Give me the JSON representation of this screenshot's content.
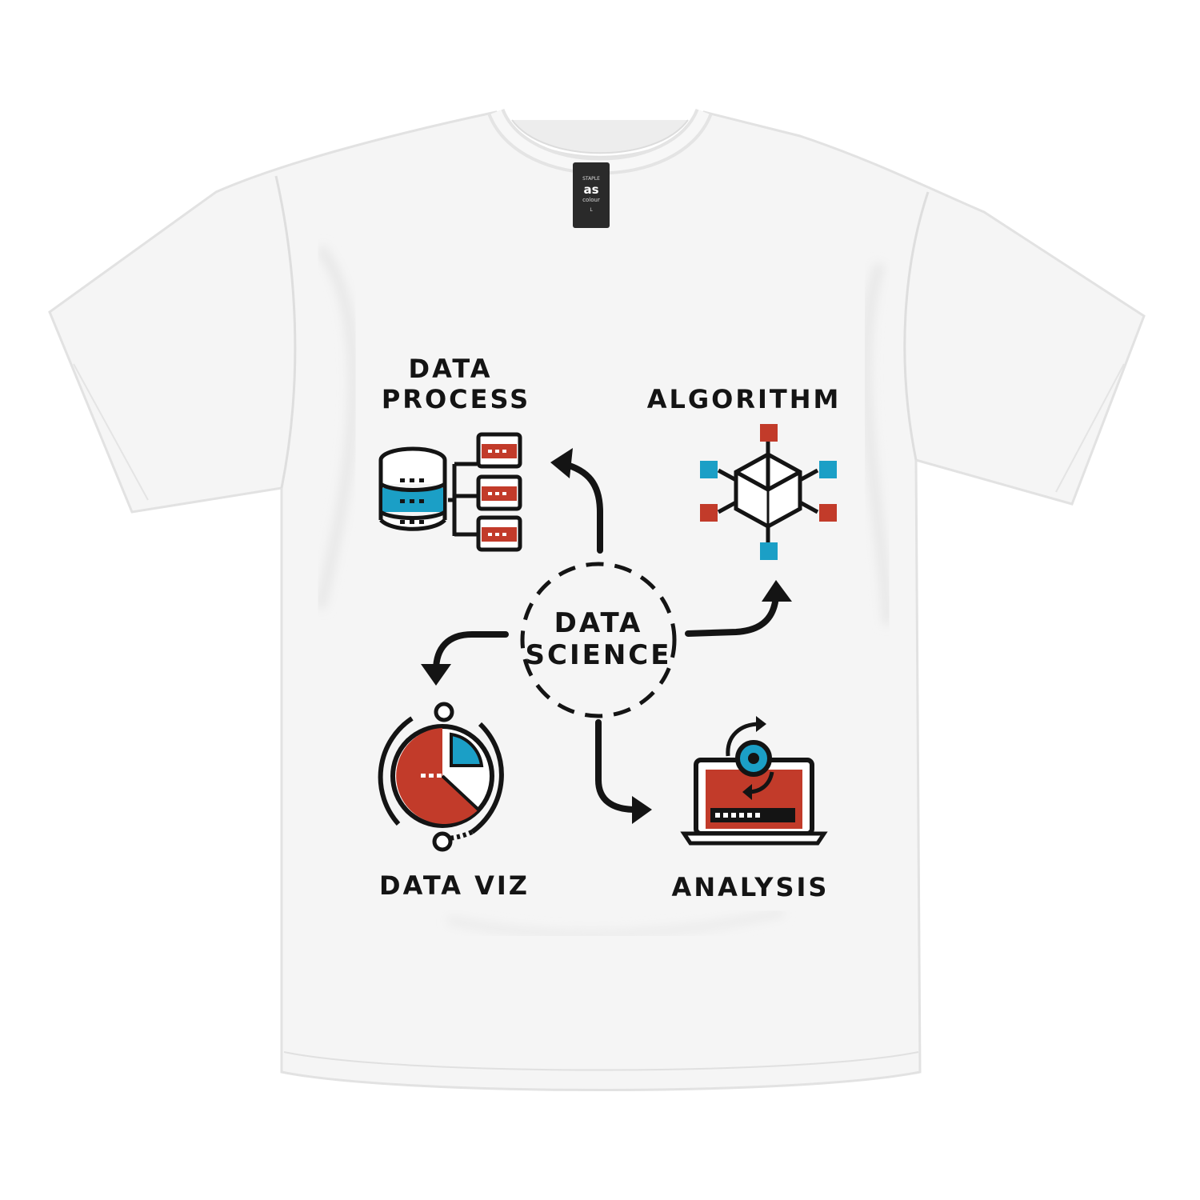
{
  "garment": {
    "kind": "t-shirt",
    "color": "#f4f4f4"
  },
  "neck_tag": {
    "brand_mark": "as colour",
    "lines": [
      "STAPLE",
      "as",
      "colour",
      "L"
    ]
  },
  "design": {
    "palette": {
      "ink": "#141414",
      "red": "#c23b2a",
      "blue": "#1b9fc6"
    },
    "center": {
      "line1": "DATA",
      "line2": "SCIENCE"
    },
    "nodes": {
      "data_process": {
        "line1": "DATA",
        "line2": "PROCESS",
        "icon": "database-icon"
      },
      "algorithm": {
        "label": "ALGORITHM",
        "icon": "network-cube-icon"
      },
      "data_viz": {
        "label": "DATA VIZ",
        "icon": "pie-chart-icon"
      },
      "analysis": {
        "label": "ANALYSIS",
        "icon": "laptop-analysis-icon"
      }
    }
  }
}
